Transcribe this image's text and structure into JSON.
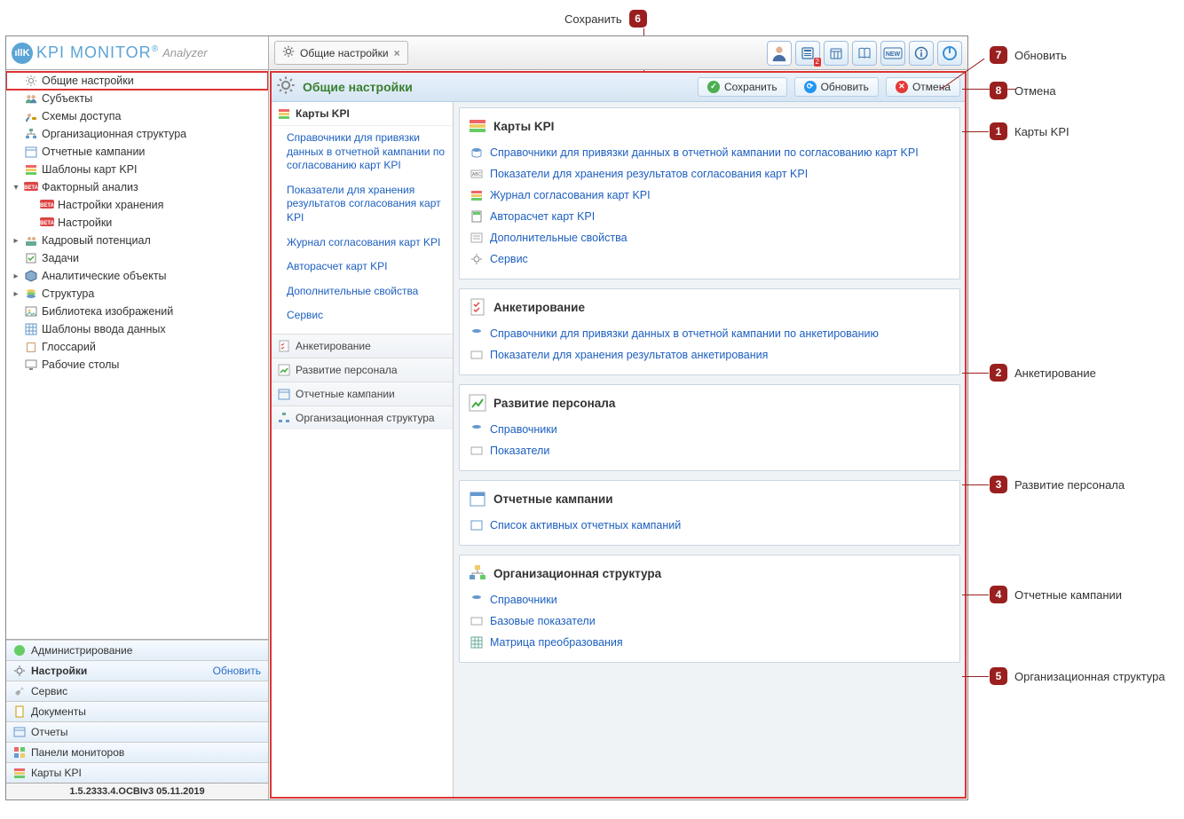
{
  "logo": {
    "brand": "KPI MONITOR",
    "sub": "Analyzer"
  },
  "tab": {
    "title": "Общие настройки"
  },
  "toolbar_badge": "2",
  "tree": {
    "items": [
      "Общие настройки",
      "Субъекты",
      "Схемы доступа",
      "Организационная структура",
      "Отчетные кампании",
      "Шаблоны карт KPI",
      "Факторный анализ"
    ],
    "factor_children": [
      "Настройки хранения",
      "Настройки"
    ],
    "items_tail": [
      "Кадровый потенциал",
      "Задачи",
      "Аналитические объекты",
      "Структура",
      "Библиотека изображений",
      "Шаблоны ввода данных",
      "Глоссарий",
      "Рабочие столы"
    ]
  },
  "bottom_nav": {
    "items": [
      "Администрирование",
      "Настройки",
      "Сервис",
      "Документы",
      "Отчеты",
      "Панели мониторов",
      "Карты KPI"
    ],
    "refresh": "Обновить"
  },
  "status": "1.5.2333.4.OCBIv3  05.11.2019",
  "main": {
    "title": "Общие настройки",
    "actions": {
      "save": "Сохранить",
      "refresh": "Обновить",
      "cancel": "Отмена"
    }
  },
  "nav_pane": {
    "kpi_title": "Карты KPI",
    "kpi_links": [
      "Справочники для привязки данных в отчетной кампании по согласованию карт KPI",
      "Показатели для хранения результатов согласования карт KPI",
      "Журнал согласования карт KPI",
      "Авторасчет карт KPI",
      "Дополнительные свойства",
      "Сервис"
    ],
    "cats": [
      "Анкетирование",
      "Развитие персонала",
      "Отчетные кампании",
      "Организационная структура"
    ]
  },
  "panels": {
    "kpi": {
      "title": "Карты KPI",
      "links": [
        "Справочники для привязки данных в отчетной кампании по согласованию карт KPI",
        "Показатели для хранения результатов согласования карт KPI",
        "Журнал согласования карт KPI",
        "Авторасчет карт KPI",
        "Дополнительные свойства",
        "Сервис"
      ]
    },
    "anket": {
      "title": "Анкетирование",
      "links": [
        "Справочники для привязки данных в отчетной кампании по анкетированию",
        "Показатели для хранения результатов анкетирования"
      ]
    },
    "staff": {
      "title": "Развитие персонала",
      "links": [
        "Справочники",
        "Показатели"
      ]
    },
    "reports": {
      "title": "Отчетные кампании",
      "links": [
        "Список активных отчетных кампаний"
      ]
    },
    "org": {
      "title": "Организационная структура",
      "links": [
        "Справочники",
        "Базовые показатели",
        "Матрица преобразования"
      ]
    }
  },
  "callouts": {
    "c1": "Карты KPI",
    "c2": "Анкетирование",
    "c3": "Развитие персонала",
    "c4": "Отчетные кампании",
    "c5": "Организационная структура",
    "c6": "Сохранить",
    "c7": "Обновить",
    "c8": "Отмена"
  }
}
